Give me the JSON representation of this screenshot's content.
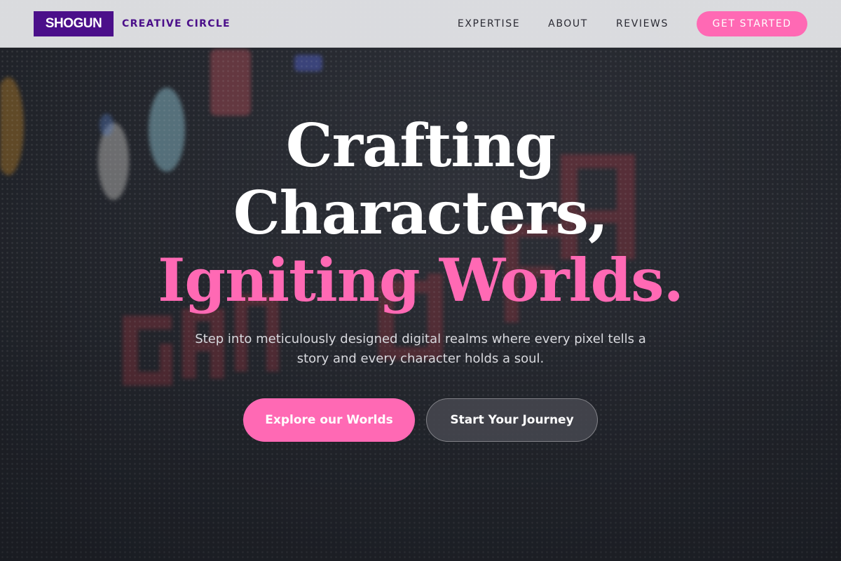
{
  "header": {
    "logo_text": "SHOGUN",
    "logo_subtitle": "CREATIVE CIRCLE",
    "nav": [
      {
        "label": "EXPERTISE"
      },
      {
        "label": "ABOUT"
      },
      {
        "label": "REVIEWS"
      }
    ],
    "cta_label": "GET STARTED"
  },
  "hero": {
    "headline_line1": "Crafting",
    "headline_line2": "Characters,",
    "headline_line3": "Igniting Worlds.",
    "subtitle": "Step into meticulously designed digital realms where every pixel tells a story and every character holds a soul.",
    "primary_button": "Explore our Worlds",
    "secondary_button": "Start Your Journey",
    "background_text": "GAME OVER"
  },
  "colors": {
    "brand_purple": "#4b0f8a",
    "accent_pink": "#ff69b4",
    "header_bg": "#e2e3e6",
    "hero_dark": "#2a2d33"
  }
}
